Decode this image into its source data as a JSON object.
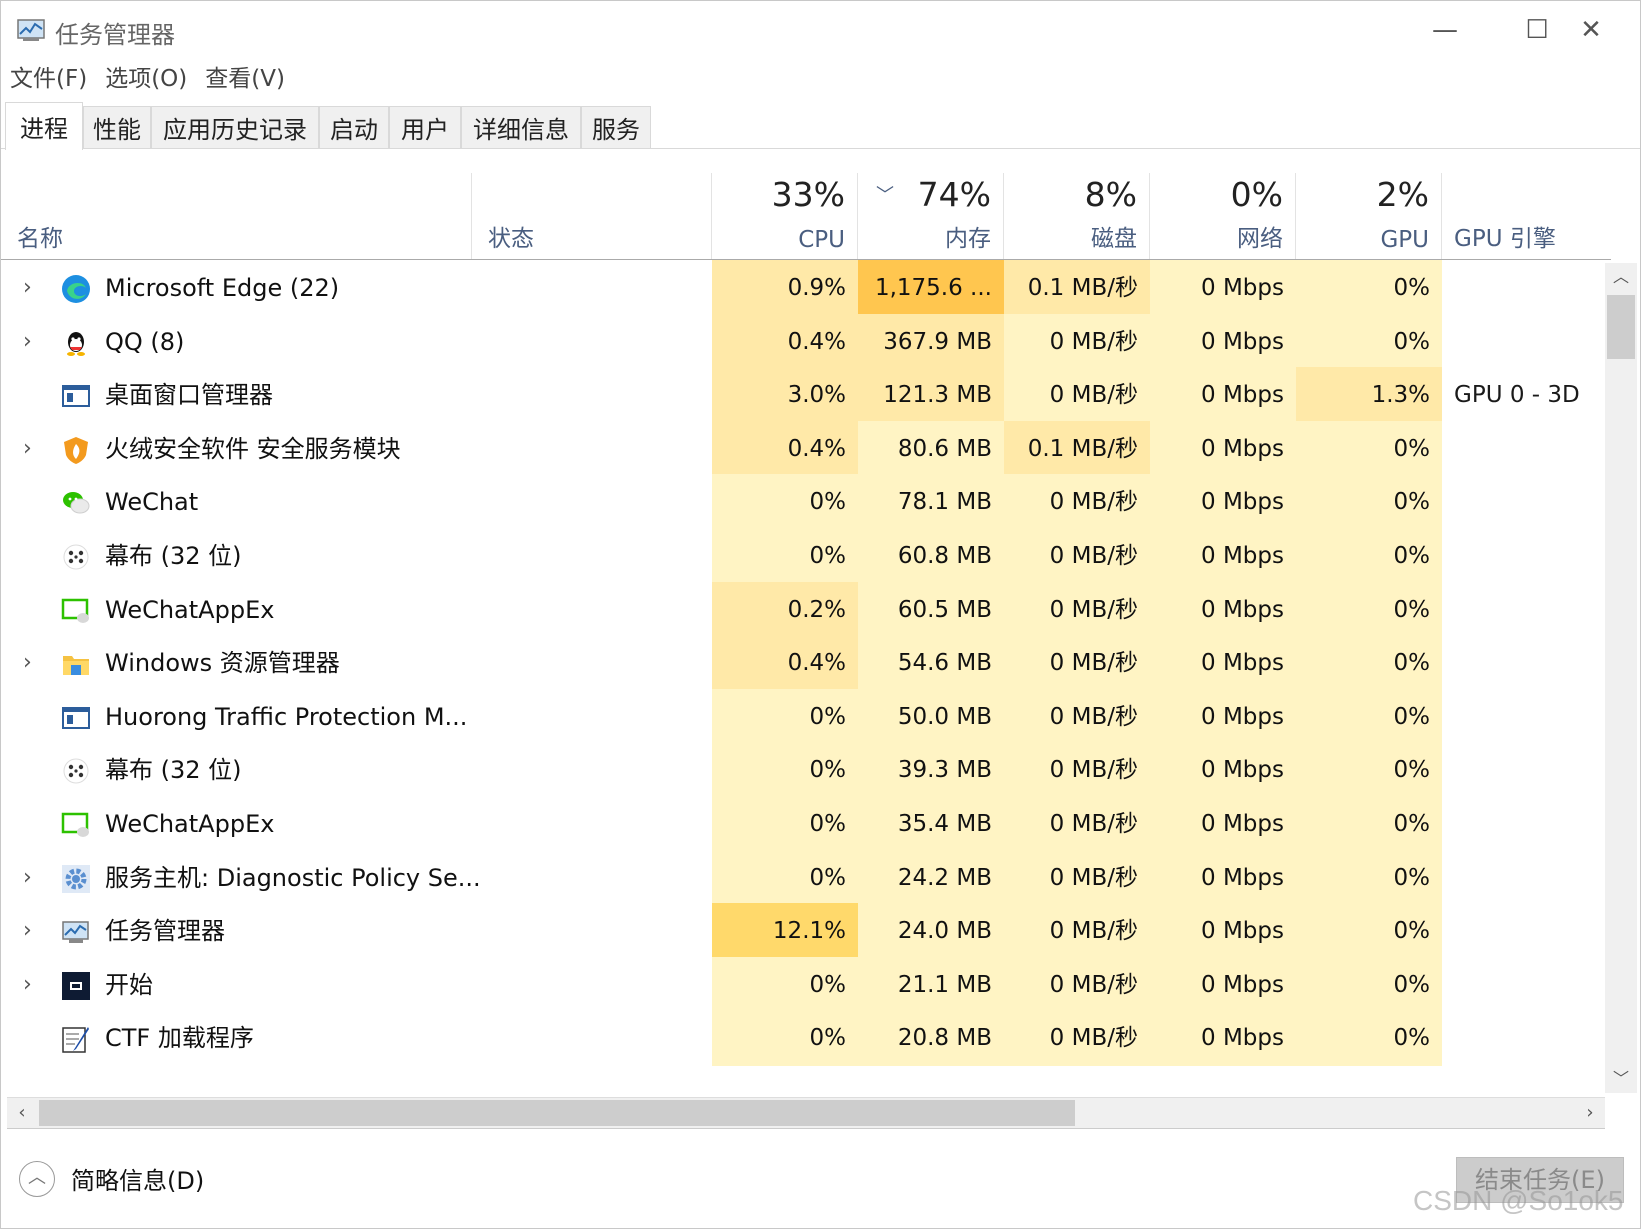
{
  "window": {
    "title": "任务管理器",
    "controls": {
      "minimize": "—",
      "maximize": "☐",
      "close": "✕"
    }
  },
  "menu": [
    "文件(F)",
    "选项(O)",
    "查看(V)"
  ],
  "tabs": [
    "进程",
    "性能",
    "应用历史记录",
    "启动",
    "用户",
    "详细信息",
    "服务"
  ],
  "active_tab": "进程",
  "columns": {
    "name": "名称",
    "status": "状态",
    "cpu": {
      "pct": "33%",
      "label": "CPU"
    },
    "mem": {
      "pct": "74%",
      "label": "内存"
    },
    "disk": {
      "pct": "8%",
      "label": "磁盘"
    },
    "net": {
      "pct": "0%",
      "label": "网络"
    },
    "gpu": {
      "pct": "2%",
      "label": "GPU"
    },
    "gpu_engine": "GPU 引擎"
  },
  "rows": [
    {
      "name": "Microsoft Edge (22)",
      "expandable": true,
      "icon": "edge-icon",
      "cpu": "0.9%",
      "mem": "1,175.6 ...",
      "disk": "0.1 MB/秒",
      "net": "0 Mbps",
      "gpu": "0%",
      "gpu_engine": ""
    },
    {
      "name": "QQ (8)",
      "expandable": true,
      "icon": "qq-icon",
      "cpu": "0.4%",
      "mem": "367.9 MB",
      "disk": "0 MB/秒",
      "net": "0 Mbps",
      "gpu": "0%",
      "gpu_engine": ""
    },
    {
      "name": "桌面窗口管理器",
      "expandable": false,
      "icon": "window-icon",
      "cpu": "3.0%",
      "mem": "121.3 MB",
      "disk": "0 MB/秒",
      "net": "0 Mbps",
      "gpu": "1.3%",
      "gpu_engine": "GPU 0 - 3D"
    },
    {
      "name": "火绒安全软件 安全服务模块",
      "expandable": true,
      "icon": "huorong-shield-icon",
      "cpu": "0.4%",
      "mem": "80.6 MB",
      "disk": "0.1 MB/秒",
      "net": "0 Mbps",
      "gpu": "0%",
      "gpu_engine": ""
    },
    {
      "name": "WeChat",
      "expandable": false,
      "icon": "wechat-icon",
      "cpu": "0%",
      "mem": "78.1 MB",
      "disk": "0 MB/秒",
      "net": "0 Mbps",
      "gpu": "0%",
      "gpu_engine": ""
    },
    {
      "name": "幕布 (32 位)",
      "expandable": false,
      "icon": "mubu-icon",
      "cpu": "0%",
      "mem": "60.8 MB",
      "disk": "0 MB/秒",
      "net": "0 Mbps",
      "gpu": "0%",
      "gpu_engine": ""
    },
    {
      "name": "WeChatAppEx",
      "expandable": false,
      "icon": "wechatappex-icon",
      "cpu": "0.2%",
      "mem": "60.5 MB",
      "disk": "0 MB/秒",
      "net": "0 Mbps",
      "gpu": "0%",
      "gpu_engine": ""
    },
    {
      "name": "Windows 资源管理器",
      "expandable": true,
      "icon": "folder-icon",
      "cpu": "0.4%",
      "mem": "54.6 MB",
      "disk": "0 MB/秒",
      "net": "0 Mbps",
      "gpu": "0%",
      "gpu_engine": ""
    },
    {
      "name": "Huorong Traffic Protection M...",
      "expandable": false,
      "icon": "window-icon",
      "cpu": "0%",
      "mem": "50.0 MB",
      "disk": "0 MB/秒",
      "net": "0 Mbps",
      "gpu": "0%",
      "gpu_engine": ""
    },
    {
      "name": "幕布 (32 位)",
      "expandable": false,
      "icon": "mubu-icon",
      "cpu": "0%",
      "mem": "39.3 MB",
      "disk": "0 MB/秒",
      "net": "0 Mbps",
      "gpu": "0%",
      "gpu_engine": ""
    },
    {
      "name": "WeChatAppEx",
      "expandable": false,
      "icon": "wechatappex-icon",
      "cpu": "0%",
      "mem": "35.4 MB",
      "disk": "0 MB/秒",
      "net": "0 Mbps",
      "gpu": "0%",
      "gpu_engine": ""
    },
    {
      "name": "服务主机: Diagnostic Policy Se...",
      "expandable": true,
      "icon": "gear-icon",
      "cpu": "0%",
      "mem": "24.2 MB",
      "disk": "0 MB/秒",
      "net": "0 Mbps",
      "gpu": "0%",
      "gpu_engine": ""
    },
    {
      "name": "任务管理器",
      "expandable": true,
      "icon": "taskmgr-icon",
      "cpu": "12.1%",
      "mem": "24.0 MB",
      "disk": "0 MB/秒",
      "net": "0 Mbps",
      "gpu": "0%",
      "gpu_engine": ""
    },
    {
      "name": "开始",
      "expandable": true,
      "icon": "start-icon",
      "cpu": "0%",
      "mem": "21.1 MB",
      "disk": "0 MB/秒",
      "net": "0 Mbps",
      "gpu": "0%",
      "gpu_engine": ""
    },
    {
      "name": "CTF 加载程序",
      "expandable": false,
      "icon": "ctf-pen-icon",
      "cpu": "0%",
      "mem": "20.8 MB",
      "disk": "0 MB/秒",
      "net": "0 Mbps",
      "gpu": "0%",
      "gpu_engine": ""
    }
  ],
  "footer": {
    "collapse_label": "简略信息(D)",
    "end_task": "结束任务(E)"
  },
  "watermark": "CSDN @So1ok5",
  "colors": {
    "heat_base": "#fff4c4",
    "heat_mid": "#ffe9a8",
    "heat_high": "#ffd96b",
    "heat_top": "#ffc64f"
  }
}
